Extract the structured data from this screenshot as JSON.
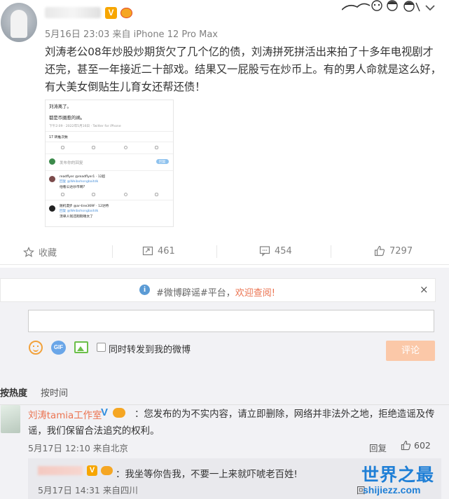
{
  "post": {
    "meta": "5月16日 23:03 来自 iPhone 12 Pro Max",
    "text": "刘涛老公08年炒股炒期货欠了几个亿的债，刘涛拼死拼活出来拍了十多年电视剧才还完，甚至一年接近二十部戏。结果又一屁股亏在炒币上。有的男人命就是这么好，有大美女倒贴生儿育女还帮还债！",
    "vip_badge": "V"
  },
  "embedded": {
    "line1": "刘涛离了。",
    "line2": "都是币圈惹的祸。",
    "time": "下午2:09 · 2022年5月16日 · Twitter for iPhone",
    "retweets": "17 转推次数",
    "reply_prompt": "发布你的回复",
    "reply_btn": "回复",
    "r1_user": "readflyer @readflyer1 · 12超",
    "r1_to": "回复 @Weibohongbaitdk",
    "r1_text": "他看公达炒币啊?",
    "r2_user": "随机漫步 @ar-tine369F · 12达特",
    "r2_to": "回复 @Weibohongbaitdk",
    "r2_text": "溃单人钱还刚刚嘻太了"
  },
  "actions": {
    "fav": "收藏",
    "repost": "461",
    "comment": "454",
    "like": "7297"
  },
  "notice": {
    "prefix": "#微博辟谣#平台，",
    "link": "欢迎查阅!",
    "close": "×"
  },
  "composer": {
    "gif": "GIF",
    "forward_label": "同时转发到我的微博",
    "submit": "评论"
  },
  "sort": {
    "hot": "按热度",
    "time": "按时间"
  },
  "comment": {
    "name": "刘涛tamia工作室",
    "v": "V",
    "text": "：您发布的为不实内容，请立即删除，网络并非法外之地，拒绝造谣及传谣，我们保留合法追究的权利。",
    "meta": "5月17日 12:10 来自北京",
    "reply": "回复",
    "likes": "602"
  },
  "subreply": {
    "v": "V",
    "text": "：我坐等你告我，不要一上来就吓唬老百姓!",
    "meta": "5月17日 14:31 来自四川",
    "reply": "回"
  },
  "watermark": {
    "title": "世界之最",
    "url": "shijiezz.com"
  }
}
